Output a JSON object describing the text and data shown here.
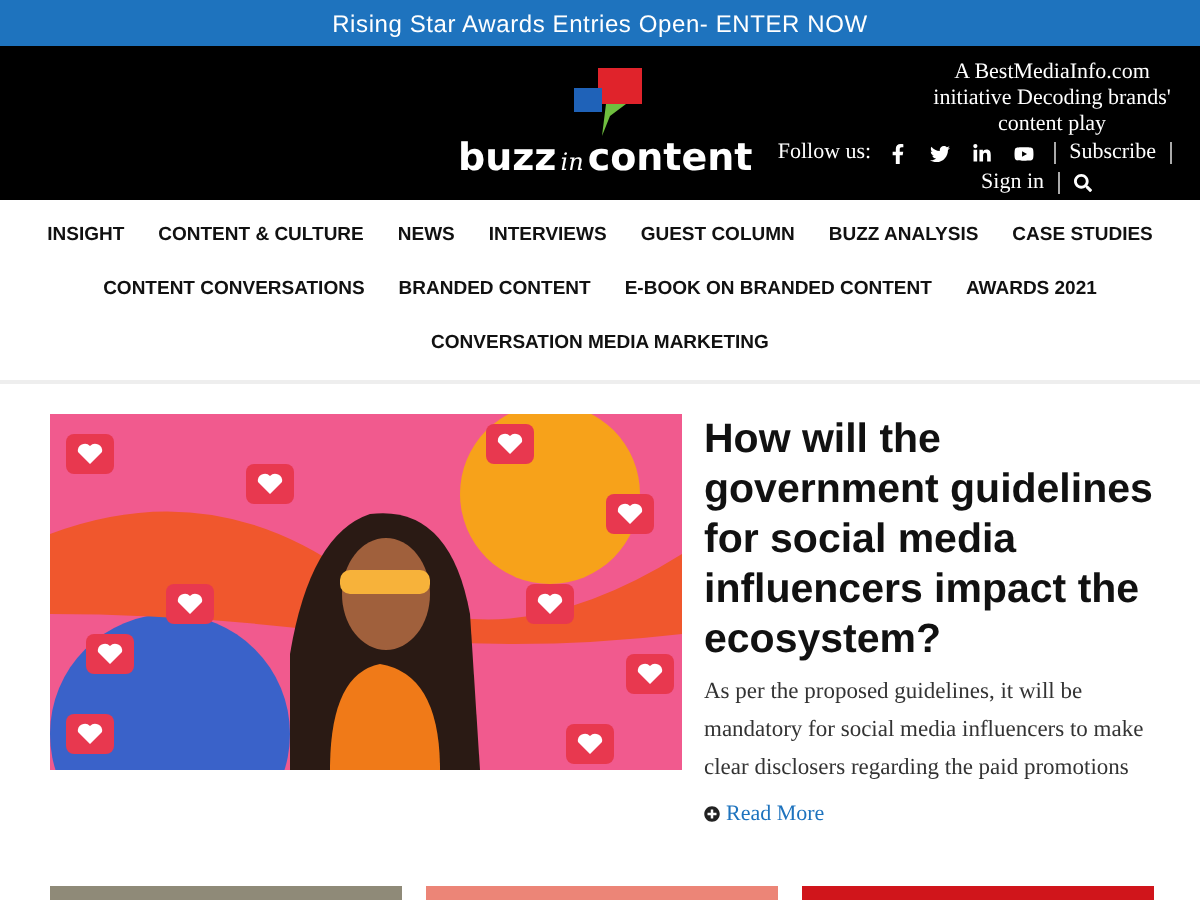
{
  "announcement": "Rising Star Awards Entries Open- ENTER NOW",
  "header": {
    "logo": {
      "part_1": "buzz",
      "part_2": "in",
      "part_3": "content"
    },
    "tagline": "A BestMediaInfo.com initiative Decoding brands' content play",
    "follow_label": "Follow us:",
    "social": [
      {
        "kind": "facebook"
      },
      {
        "kind": "twitter"
      },
      {
        "kind": "linkedin"
      },
      {
        "kind": "youtube"
      }
    ],
    "links": [
      "Subscribe",
      "Sign in"
    ]
  },
  "nav": [
    [
      "INSIGHT",
      "CONTENT & CULTURE",
      "NEWS",
      "INTERVIEWS",
      "GUEST COLUMN",
      "BUZZ ANALYSIS",
      "CASE STUDIES"
    ],
    [
      "CONTENT CONVERSATIONS",
      "BRANDED CONTENT",
      "E-BOOK ON BRANDED CONTENT",
      "AWARDS 2021"
    ],
    [
      "CONVERSATION MEDIA MARKETING"
    ]
  ],
  "featured": {
    "headline": "How will the government guidelines for social media influencers impact the ecosystem?",
    "summary": "As per the proposed guidelines, it will be mandatory for social media influencers to make clear disclosers regarding the paid promotions",
    "read_more": "Read More"
  },
  "thumbnails": [
    {
      "kind": "photo"
    },
    {
      "kind": "graphic"
    },
    {
      "kind": "photo-red"
    }
  ]
}
